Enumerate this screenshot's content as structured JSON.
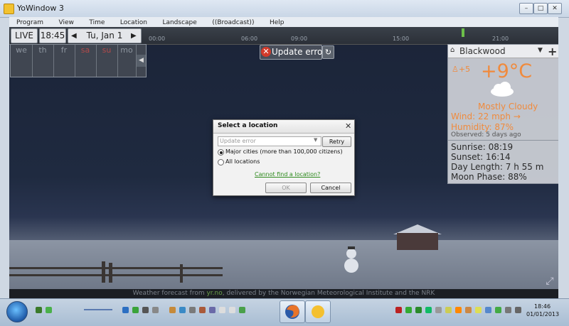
{
  "window": {
    "title": "YoWindow 3",
    "controls": [
      "–",
      "□",
      "✕"
    ]
  },
  "menu": [
    "Program",
    "View",
    "Time",
    "Location",
    "Landscape",
    "((Broadcast))",
    "Help"
  ],
  "timeline": {
    "live_label": "LIVE",
    "time": "18:45",
    "date": "Tu, Jan 1",
    "hours": [
      "00:00",
      "06:00",
      "09:00",
      "15:00",
      "21:00"
    ]
  },
  "days": [
    {
      "label": "we",
      "weekend": false
    },
    {
      "label": "th",
      "weekend": false
    },
    {
      "label": "fr",
      "weekend": false
    },
    {
      "label": "sa",
      "weekend": true
    },
    {
      "label": "su",
      "weekend": true
    },
    {
      "label": "mo",
      "weekend": false
    }
  ],
  "status": {
    "update_error": "Update error"
  },
  "weather": {
    "location": "Blackwood",
    "temperature": "+9°C",
    "feels_like": "+5",
    "condition": "Mostly Cloudy",
    "wind": "Wind:  22 mph →",
    "humidity": "Humidity:  87%",
    "observed": "Observed:  5 days ago",
    "icon": "cloud-icon"
  },
  "sun": {
    "sunrise": "Sunrise:  08:19",
    "sunset": "Sunset:   16:14",
    "day_length": "Day Length:  7 h 55 m",
    "moon_phase": "Moon Phase:  88%"
  },
  "footer": {
    "prefix": "Weather forecast from ",
    "link": "yr.no",
    "suffix": ", delivered by the Norwegian Meteorological Institute and the NRK"
  },
  "dialog": {
    "title": "Select a location",
    "select_value": "Update error",
    "retry": "Retry",
    "option_major": "Major cities (more than 100,000 citizens)",
    "option_all": "All locations",
    "selected_option": "major",
    "link": "Cannot find a location?",
    "ok": "OK",
    "cancel": "Cancel"
  },
  "taskbar": {
    "clock_time": "18:46",
    "clock_date": "01/01/2013"
  },
  "colors": {
    "accent_orange": "#f08a3c",
    "error_red": "#d23a2a",
    "link_green": "#2e8a1e"
  }
}
